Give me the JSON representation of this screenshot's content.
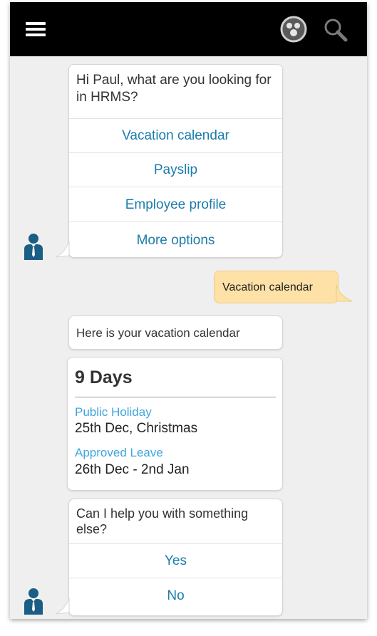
{
  "header": {
    "menu_icon": "hamburger-menu-icon",
    "avatar_icon": "user-avatar-icon",
    "search_icon": "search-icon"
  },
  "greeting": {
    "question": "Hi Paul, what are you looking for in HRMS?",
    "options": [
      "Vacation calendar",
      "Payslip",
      "Employee profile",
      "More options"
    ]
  },
  "user_reply": "Vacation calendar",
  "vacation_intro": "Here is your vacation calendar",
  "vacation_card": {
    "total": "9 Days",
    "entries": [
      {
        "label": "Public Holiday",
        "value": "25th Dec, Christmas"
      },
      {
        "label": "Approved Leave",
        "value": "26th Dec - 2nd Jan"
      }
    ]
  },
  "followup": {
    "question": "Can I help you with something else?",
    "options": [
      "Yes",
      "No"
    ]
  },
  "colors": {
    "topbar": "#000000",
    "accent": "#1b7cab",
    "label": "#3fa6dd",
    "user_bubble": "#fde1a6",
    "bot_avatar": "#1a5d85"
  }
}
